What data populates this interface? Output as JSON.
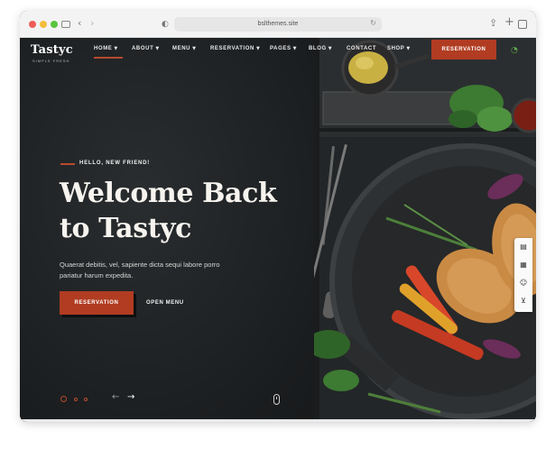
{
  "browser": {
    "url": "bslthemes.site",
    "icons": [
      "sidebar-icon",
      "back-icon",
      "forward-icon",
      "shield-icon",
      "reload-icon",
      "share-icon",
      "plus-icon",
      "tabs-icon"
    ]
  },
  "site": {
    "logo": "Tastyc",
    "logo_sub": "SIMPLE FRESH"
  },
  "nav": {
    "items": [
      {
        "label": "HOME"
      },
      {
        "label": "ABOUT"
      },
      {
        "label": "MENU"
      },
      {
        "label": "RESERVATION"
      },
      {
        "label": "PAGES"
      },
      {
        "label": "BLOG"
      },
      {
        "label": "CONTACT"
      },
      {
        "label": "SHOP"
      }
    ],
    "active_index": 0,
    "button_label": "RESERVATION"
  },
  "hero": {
    "eyebrow": "HELLO, NEW FRIEND!",
    "title": "Welcome Back to Tastyc",
    "description": "Quaerat debitis, vel, sapiente dicta sequi labore porro pariatur harum expedita.",
    "primary_button": "RESERVATION",
    "secondary_button": "OPEN MENU"
  },
  "slider": {
    "slide_count": 3,
    "active_slide": 1
  },
  "toolbar": {
    "icons": [
      "document-icon",
      "code-icon",
      "support-icon",
      "cart-icon"
    ]
  },
  "colors": {
    "accent": "#b13c22",
    "background": "#1e2123",
    "text_light": "#f7f4ef"
  }
}
